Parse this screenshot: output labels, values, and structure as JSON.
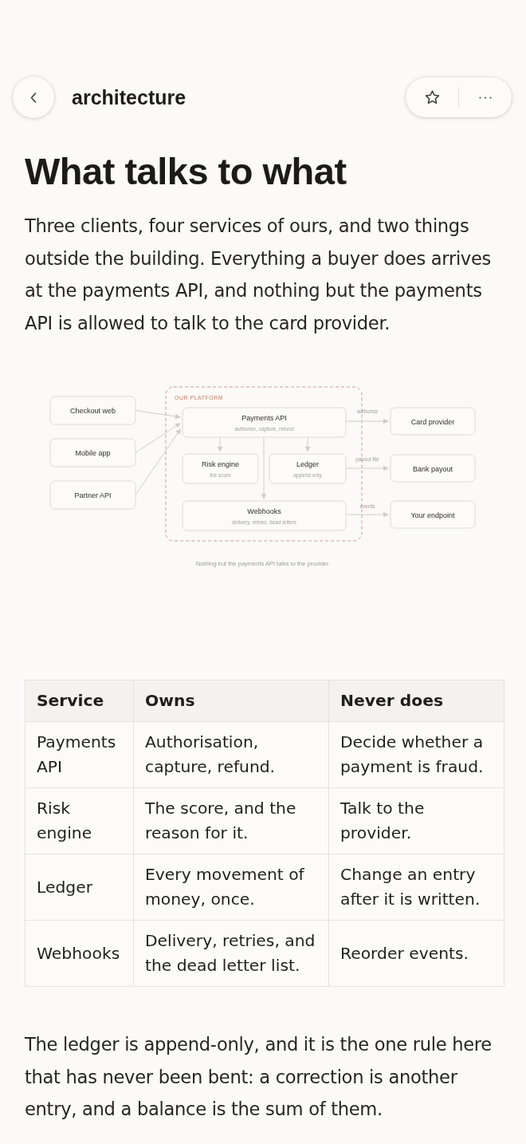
{
  "header": {
    "title": "architecture"
  },
  "heading": "What talks to what",
  "intro": "Three clients, four services of ours, and two things outside the building. Everything a buyer does arrives at the payments API, and nothing but the payments API is allowed to talk to the card provider.",
  "diagram": {
    "group_label": "OUR PLATFORM",
    "clients": [
      {
        "name": "Checkout web"
      },
      {
        "name": "Mobile app"
      },
      {
        "name": "Partner API"
      }
    ],
    "services": [
      {
        "name": "Payments API",
        "note": "authorise, capture, refund"
      },
      {
        "name": "Risk engine",
        "note": "the score"
      },
      {
        "name": "Ledger",
        "note": "append only"
      },
      {
        "name": "Webhooks",
        "note": "delivery, retries, dead letters"
      }
    ],
    "externals": [
      {
        "name": "Card provider",
        "flow": "authorise"
      },
      {
        "name": "Bank payout",
        "flow": "payout file"
      },
      {
        "name": "Your endpoint",
        "flow": "events"
      }
    ],
    "caption": "Nothing but the payments API talks to the provider."
  },
  "table": {
    "columns": [
      "Service",
      "Owns",
      "Never does"
    ],
    "rows": [
      [
        "Payments API",
        "Authorisation, capture, refund.",
        "Decide whether a payment is fraud."
      ],
      [
        "Risk engine",
        "The score, and the reason for it.",
        "Talk to the provider."
      ],
      [
        "Ledger",
        "Every movement of money, once.",
        "Change an entry after it is written."
      ],
      [
        "Webhooks",
        "Delivery, retries, and the dead letter list.",
        "Reorder events."
      ]
    ]
  },
  "closing": "The ledger is append-only, and it is the one rule here that has never been bent: a correction is another entry, and a balance is the sum of them."
}
